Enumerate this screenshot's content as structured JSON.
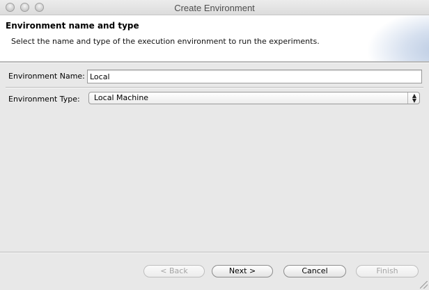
{
  "window": {
    "title": "Create Environment"
  },
  "banner": {
    "title": "Environment name and type",
    "description": "Select the name and type of the execution environment to run the experiments."
  },
  "form": {
    "name_label": "Environment Name:",
    "name_value": "Local",
    "type_label": "Environment Type:",
    "type_value": "Local Machine"
  },
  "buttons": {
    "back": "< Back",
    "next": "Next >",
    "cancel": "Cancel",
    "finish": "Finish"
  },
  "colors": {
    "background": "#e8e8e8",
    "banner": "#ffffff",
    "banner_accent": "#b9c9e1"
  }
}
